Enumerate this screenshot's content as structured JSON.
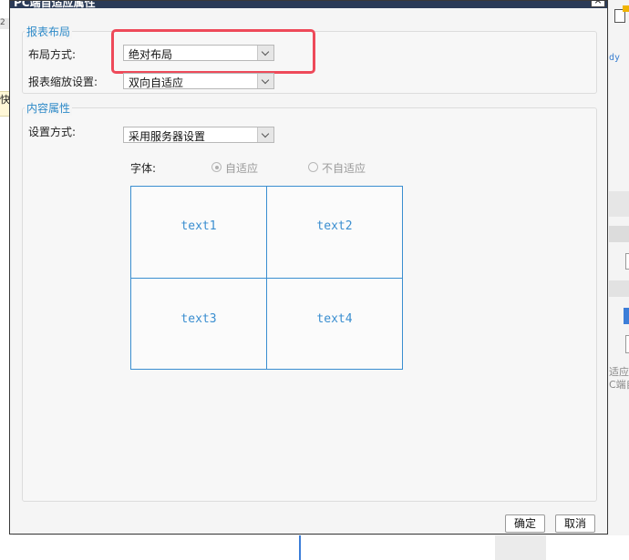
{
  "background": {
    "left_band_text": "2",
    "left_yellow_text": "快",
    "right_code_text": "dy",
    "right_text_line1": "适应",
    "right_text_line2": "C端自"
  },
  "dialog": {
    "title": "PC端自适应属性",
    "close_label": "×",
    "report_layout": {
      "group_title": "报表布局",
      "layout_mode_label": "布局方式:",
      "layout_mode_value": "绝对布局",
      "zoom_label": "报表缩放设置:",
      "zoom_value": "双向自适应"
    },
    "content": {
      "group_title": "内容属性",
      "setting_mode_label": "设置方式:",
      "setting_mode_value": "采用服务器设置",
      "font_label": "字体:",
      "radio_adaptive": "自适应",
      "radio_not_adaptive": "不自适应",
      "preview_cells": [
        "text1",
        "text2",
        "text3",
        "text4"
      ]
    },
    "buttons": {
      "ok": "确定",
      "cancel": "取消"
    }
  },
  "colors": {
    "accent": "#2e8ac8",
    "highlight": "#ee4a5a",
    "titlebar": "#2b3b57"
  }
}
